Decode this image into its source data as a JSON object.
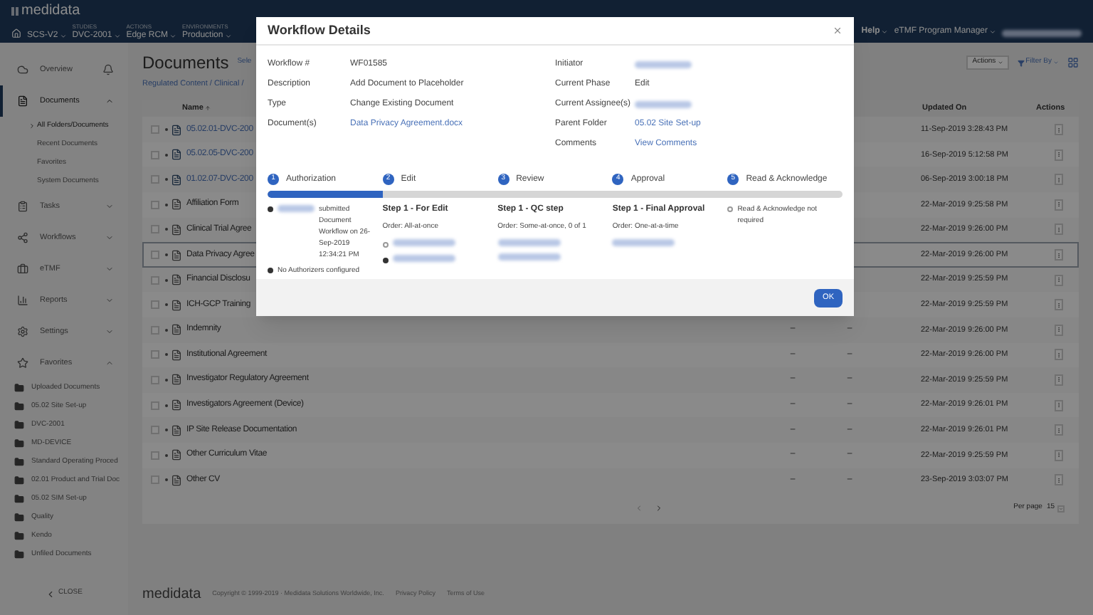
{
  "header": {
    "logo": "medidata",
    "nav": [
      {
        "value": "SCS-V2"
      },
      {
        "caption": "STUDIES",
        "value": "DVC-2001"
      },
      {
        "caption": "ACTIONS",
        "value": "Edge RCM"
      },
      {
        "caption": "ENVIRONMENTS",
        "value": "Production"
      }
    ],
    "right": [
      "Help",
      "eTMF Program Manager"
    ]
  },
  "sidebar": {
    "items": [
      {
        "kind": "link",
        "label": "Overview",
        "selected": false
      },
      {
        "kind": "group",
        "label": "Documents",
        "selected": true,
        "expanded": true,
        "children": [
          {
            "label": "All Folders/Documents",
            "selected": true
          },
          {
            "label": "Recent Documents",
            "selected": false
          },
          {
            "label": "Favorites",
            "selected": false
          },
          {
            "label": "System Documents",
            "selected": false
          }
        ]
      },
      {
        "kind": "group",
        "label": "Tasks",
        "selected": false,
        "expanded": false
      },
      {
        "kind": "group",
        "label": "Workflows",
        "selected": false,
        "expanded": false
      },
      {
        "kind": "group",
        "label": "eTMF",
        "selected": false,
        "expanded": false
      },
      {
        "kind": "group",
        "label": "Reports",
        "selected": false,
        "expanded": false
      },
      {
        "kind": "group",
        "label": "Settings",
        "selected": false,
        "expanded": false
      },
      {
        "kind": "folders",
        "label": "Favorites",
        "selected": false,
        "expanded": true,
        "children": [
          {
            "label": "Uploaded Documents"
          },
          {
            "label": "05.02 Site Set-up"
          },
          {
            "label": "DVC-2001"
          },
          {
            "label": "MD-DEVICE"
          },
          {
            "label": "Standard Operating Proced"
          },
          {
            "label": "02.01 Product and Trial Doc"
          },
          {
            "label": "05.02 SIM Set-up"
          },
          {
            "label": "Quality"
          },
          {
            "label": "Kendo"
          },
          {
            "label": "Unfiled Documents"
          }
        ]
      }
    ],
    "close": "CLOSE"
  },
  "toolbar": {
    "title": "Documents",
    "select": "Sele",
    "breadcrumb": "Regulated Content / Clinical /",
    "actions": "Actions",
    "filter": "Filter By"
  },
  "table": {
    "columns": [
      "Name",
      "Updated On",
      "Actions"
    ],
    "rows": [
      {
        "name": "05.02.01-DVC-200",
        "link": true,
        "updated": "11-Sep-2019 3:28:43 PM",
        "selected": false
      },
      {
        "name": "05.02.05-DVC-200",
        "link": true,
        "updated": "16-Sep-2019 5:12:58 PM",
        "selected": false
      },
      {
        "name": "01.02.07-DVC-200",
        "link": true,
        "updated": "06-Sep-2019 3:00:18 PM",
        "selected": false
      },
      {
        "name": "Affiliation Form",
        "link": false,
        "updated": "22-Mar-2019 9:25:58 PM",
        "selected": false
      },
      {
        "name": "Clinical Trial Agree",
        "link": false,
        "updated": "22-Mar-2019 9:26:00 PM",
        "selected": false
      },
      {
        "name": "Data Privacy Agree",
        "link": false,
        "updated": "22-Mar-2019 9:26:00 PM",
        "selected": true
      },
      {
        "name": "Financial Disclosu",
        "link": false,
        "updated": "22-Mar-2019 9:25:59 PM",
        "selected": false
      },
      {
        "name": "ICH-GCP Training",
        "link": false,
        "updated": "22-Mar-2019 9:25:59 PM",
        "selected": false
      },
      {
        "name": "Indemnity",
        "link": false,
        "col_3": "–",
        "col_4": "–",
        "updated": "22-Mar-2019 9:26:00 PM",
        "selected": false
      },
      {
        "name": "Institutional Agreement",
        "link": false,
        "col_3": "–",
        "col_4": "–",
        "updated": "22-Mar-2019 9:26:00 PM",
        "selected": false
      },
      {
        "name": "Investigator Regulatory Agreement",
        "link": false,
        "col_3": "–",
        "col_4": "–",
        "updated": "22-Mar-2019 9:25:59 PM",
        "selected": false
      },
      {
        "name": "Investigators Agreement (Device)",
        "link": false,
        "col_3": "–",
        "col_4": "–",
        "updated": "22-Mar-2019 9:26:01 PM",
        "selected": false
      },
      {
        "name": "IP Site Release Documentation",
        "link": false,
        "col_3": "–",
        "col_4": "–",
        "updated": "22-Mar-2019 9:26:01 PM",
        "selected": false
      },
      {
        "name": "Other Curriculum Vitae",
        "link": false,
        "col_3": "–",
        "col_4": "–",
        "updated": "22-Mar-2019 9:25:59 PM",
        "selected": false
      },
      {
        "name": "Other CV",
        "link": false,
        "col_3": "–",
        "col_4": "–",
        "updated": "23-Sep-2019 3:03:07 PM",
        "selected": false
      }
    ],
    "per_page_label": "Per page",
    "per_page": "15"
  },
  "footer": {
    "logo": "medidata",
    "copyright": "Copyright © 1999-2019 · Medidata Solutions Worldwide, Inc.",
    "links": [
      "Privacy Policy",
      "Terms of Use"
    ]
  },
  "modal": {
    "title": "Workflow Details",
    "left": [
      {
        "label": "Workflow #",
        "kind": "text",
        "value": "WF01585"
      },
      {
        "label": "Description",
        "kind": "text",
        "value": "Add Document to Placeholder"
      },
      {
        "label": "Type",
        "kind": "text",
        "value": "Change Existing Document"
      },
      {
        "label": "Document(s)",
        "kind": "link",
        "value": "Data Privacy Agreement.docx"
      }
    ],
    "right": [
      {
        "label": "Initiator",
        "kind": "redacted"
      },
      {
        "label": "Current Phase",
        "kind": "text",
        "value": "Edit"
      },
      {
        "label": "Current Assignee(s)",
        "kind": "redacted"
      },
      {
        "label": "Parent Folder",
        "kind": "link",
        "value": "05.02 Site Set-up"
      },
      {
        "label": "Comments",
        "kind": "link",
        "value": "View Comments"
      }
    ],
    "steps": [
      {
        "number": "1",
        "label": "Authorization",
        "details": [
          {
            "kind": "event",
            "text": "submitted Document Workflow on 26-Sep-2019 12:34:21 PM"
          },
          {
            "kind": "dot_text",
            "text": "No Authorizers configured"
          }
        ]
      },
      {
        "number": "2",
        "label": "Edit",
        "details": [
          {
            "kind": "heading",
            "text": "Step 1 - For Edit"
          },
          {
            "kind": "text",
            "text": "Order: All-at-once"
          },
          {
            "kind": "circle_redacted"
          },
          {
            "kind": "dot_redacted"
          }
        ]
      },
      {
        "number": "3",
        "label": "Review",
        "details": [
          {
            "kind": "heading",
            "text": "Step 1 - QC step"
          },
          {
            "kind": "text",
            "text": "Order: Some-at-once, 0 of 1"
          },
          {
            "kind": "redacted"
          },
          {
            "kind": "redacted"
          }
        ]
      },
      {
        "number": "4",
        "label": "Approval",
        "details": [
          {
            "kind": "heading",
            "text": "Step 1 - Final Approval"
          },
          {
            "kind": "text",
            "text": "Order: One-at-a-time"
          },
          {
            "kind": "redacted"
          }
        ]
      },
      {
        "number": "5",
        "label": "Read & Acknowledge",
        "details": [
          {
            "kind": "circle_text",
            "text": "Read & Acknowledge not required"
          }
        ]
      }
    ],
    "progress": {
      "level": 0.2
    },
    "ok": "OK"
  }
}
